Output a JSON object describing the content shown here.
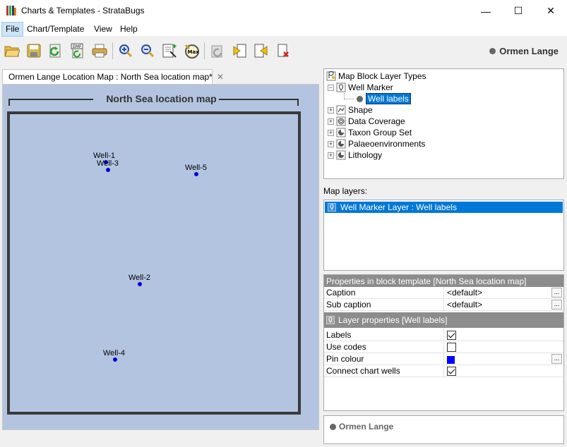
{
  "window": {
    "title": "Charts & Templates - StrataBugs",
    "minimize": "—",
    "maximize": "☐",
    "close": "✕"
  },
  "menu": [
    "File",
    "Chart/Template",
    "View",
    "Help"
  ],
  "toolbar": {
    "project": "Ormen Lange",
    "buttons": [
      "open-folder",
      "save",
      "refresh",
      "export-emf",
      "print",
      "zoom-in",
      "zoom-out",
      "fit-page",
      "zoom-level",
      "rotate-disabled",
      "prev-page",
      "next-page",
      "delete-page"
    ]
  },
  "tab": {
    "label": "Ormen Lange Location Map : North Sea location map*",
    "close": "✕"
  },
  "map": {
    "title": "North Sea location map",
    "wells": [
      {
        "label": "Well-1"
      },
      {
        "label": "Well-3"
      },
      {
        "label": "Well-5"
      },
      {
        "label": "Well-2"
      },
      {
        "label": "Well-4"
      }
    ],
    "pin_color": "#0000dd"
  },
  "tree": {
    "root": "Map Block Layer Types",
    "items": [
      {
        "label": "Well Marker",
        "expanded": true,
        "children": [
          "Well labels"
        ]
      },
      {
        "label": "Shape"
      },
      {
        "label": "Data Coverage"
      },
      {
        "label": "Taxon Group Set"
      },
      {
        "label": "Palaeoenvironments"
      },
      {
        "label": "Lithology"
      }
    ]
  },
  "map_layers": {
    "label": "Map layers:",
    "items": [
      "Well Marker Layer : Well labels"
    ]
  },
  "properties": {
    "header": "Properties in block template [North Sea location map]",
    "rows": [
      {
        "name": "Caption",
        "value": "<default>"
      },
      {
        "name": "Sub caption",
        "value": "<default>"
      }
    ],
    "layer_header": "Layer properties [Well labels]",
    "layer_rows": [
      {
        "name": "Labels",
        "checked": true
      },
      {
        "name": "Use codes",
        "checked": false
      },
      {
        "name": "Pin colour",
        "color": "#0000ff"
      },
      {
        "name": "Connect chart wells",
        "checked": true
      }
    ],
    "ellipsis": "..."
  },
  "info": {
    "project": "Ormen Lange"
  }
}
